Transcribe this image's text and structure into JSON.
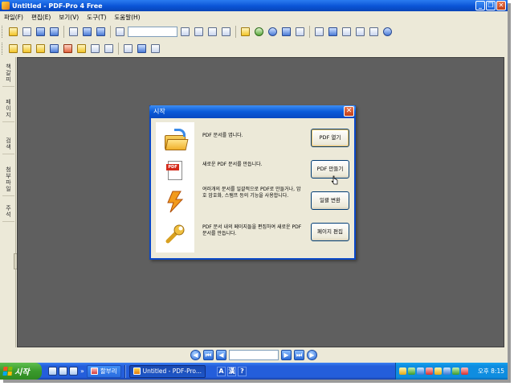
{
  "window": {
    "title": "Untitled - PDF-Pro 4 Free",
    "controls": {
      "minimize": "_",
      "restore": "❐",
      "close": "✕"
    }
  },
  "menu": [
    "파일(F)",
    "편집(E)",
    "보기(V)",
    "도구(T)",
    "도움말(H)"
  ],
  "side_tabs": [
    [
      "책",
      "갈",
      "피"
    ],
    [
      "페",
      "이",
      "지"
    ],
    [
      "검",
      "색"
    ],
    [
      "첨",
      "부",
      "파",
      "일"
    ],
    [
      "주",
      "석"
    ]
  ],
  "dialog": {
    "title": "시작",
    "close": "✕",
    "rows": [
      {
        "text": "PDF 문서를 엽니다.",
        "button": "PDF 열기"
      },
      {
        "text": "새로운 PDF 문서를 만듭니다.",
        "button": "PDF 만들기"
      },
      {
        "text": "여러개의 문서를 일괄적으로 PDF로 만들거나, 암호 암호화, 스탬프 등의 기능을 사용합니다.",
        "button": "일괄 변환"
      },
      {
        "text": "PDF 문서 내의 페이지들을 편집하여 새로운 PDF 문서를 만듭니다.",
        "button": "페이지 편집"
      }
    ],
    "icons": [
      "open-folder-icon",
      "pdf-document-icon",
      "lightning-bolt-icon",
      "wrench-icon"
    ]
  },
  "navbar": {
    "first": "⏮",
    "prev": "◀",
    "next": "▶",
    "last": "⏭"
  },
  "taskbar": {
    "start_label": "시작",
    "chevron": "»",
    "tasks": [
      {
        "label": "할부리",
        "active": false
      },
      {
        "label": "Untitled - PDF-Pro...",
        "active": true
      }
    ],
    "lang": [
      "A",
      "漢",
      "?"
    ],
    "clock": "오후 8:15"
  },
  "colors": {
    "titlebar": "#0a54d6",
    "workspace": "#5f5f5f",
    "dialog_bg": "#ece9d8",
    "taskbar": "#245edb",
    "start": "#3a9a2c"
  }
}
